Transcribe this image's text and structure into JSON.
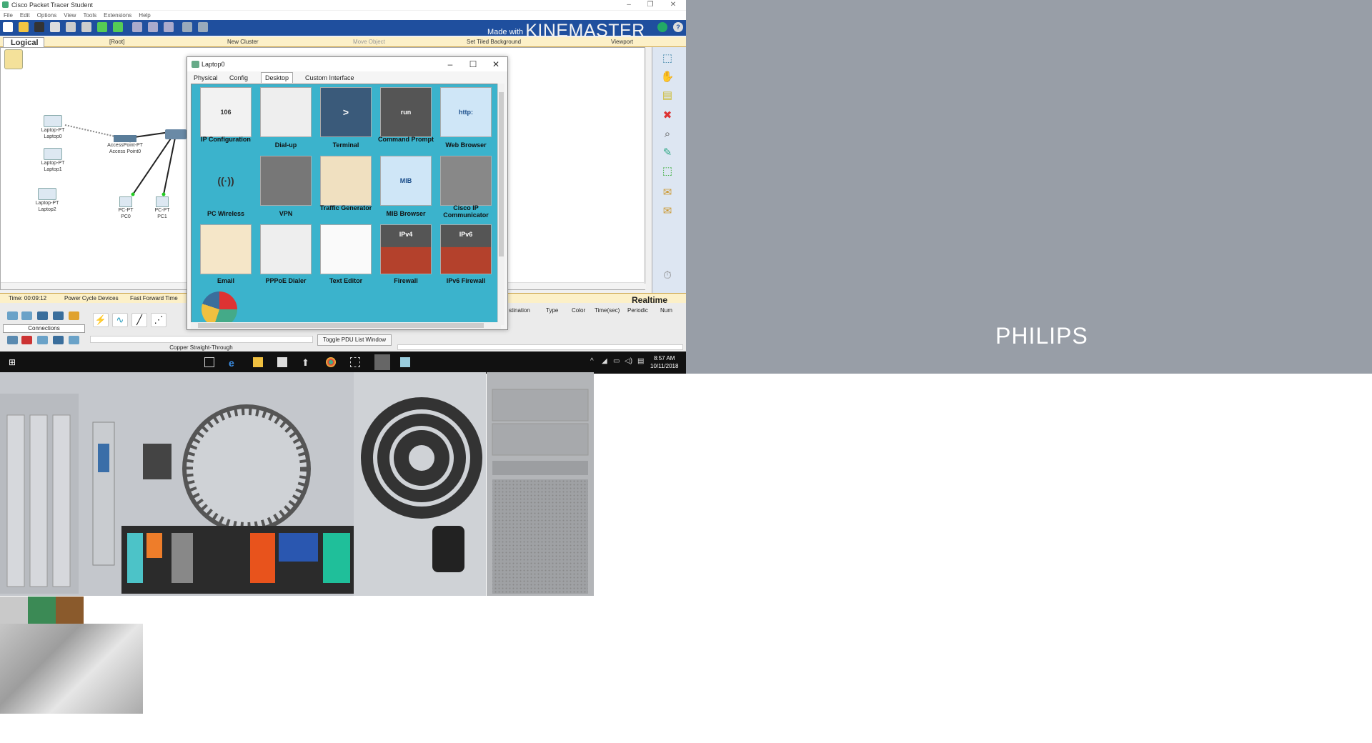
{
  "app": {
    "title": "Cisco Packet Tracer Student",
    "menu": [
      "File",
      "Edit",
      "Options",
      "View",
      "Tools",
      "Extensions",
      "Help"
    ],
    "watermark_prefix": "Made with",
    "watermark_brand": "KINEMASTER"
  },
  "nav": {
    "logical": "Logical",
    "root": "[Root]",
    "new_cluster": "New Cluster",
    "move_object": "Move Object",
    "set_tiled_background": "Set Tiled Background",
    "viewport": "Viewport"
  },
  "devices": [
    {
      "model": "Laptop-PT",
      "name": "Laptop0"
    },
    {
      "model": "AccessPoint-PT",
      "name": "Access Point0"
    },
    {
      "model": "Laptop-PT",
      "name": "Laptop1"
    },
    {
      "model": "Laptop-PT",
      "name": "Laptop2"
    },
    {
      "model": "PC-PT",
      "name": "PC0"
    },
    {
      "model": "PC-PT",
      "name": "PC1"
    }
  ],
  "status": {
    "time": "Time: 00:09:12",
    "power_cycle": "Power Cycle Devices",
    "fast_forward": "Fast Forward Time",
    "mode": "Realtime"
  },
  "bottom": {
    "connections_label": "Connections",
    "cable_label": "Copper Straight-Through",
    "toggle_pdu": "Toggle PDU List Window",
    "pdu_columns": [
      "stination",
      "Type",
      "Color",
      "Time(sec)",
      "Periodic",
      "Num"
    ]
  },
  "taskbar": {
    "time": "8:57 AM",
    "date": "10/11/2018"
  },
  "dialog": {
    "title": "Laptop0",
    "tabs": [
      "Physical",
      "Config",
      "Desktop",
      "Custom Interface"
    ],
    "active_tab": "Desktop",
    "apps": [
      {
        "label": "IP Configuration",
        "glyph": "106"
      },
      {
        "label": "Dial-up",
        "glyph": ""
      },
      {
        "label": "Terminal",
        "glyph": ">"
      },
      {
        "label": "Command Prompt",
        "glyph": "run"
      },
      {
        "label": "Web Browser",
        "glyph": "http:"
      },
      {
        "label": "PC Wireless",
        "glyph": "((·))"
      },
      {
        "label": "VPN",
        "glyph": ""
      },
      {
        "label": "Traffic Generator",
        "glyph": ""
      },
      {
        "label": "MIB Browser",
        "glyph": "MIB"
      },
      {
        "label": "Cisco IP Communicator",
        "glyph": ""
      },
      {
        "label": "Email",
        "glyph": ""
      },
      {
        "label": "PPPoE Dialer",
        "glyph": ""
      },
      {
        "label": "Text Editor",
        "glyph": ""
      },
      {
        "label": "Firewall",
        "glyph": "IPv4"
      },
      {
        "label": "IPv6 Firewall",
        "glyph": "IPv6"
      }
    ]
  },
  "philips": {
    "brand": "PHILIPS"
  },
  "colors": {
    "toolbar": "#1f4f9e",
    "desktop": "#3bb3cc",
    "nav": "#fcf0c8",
    "philips_bg": "#989ea7"
  }
}
